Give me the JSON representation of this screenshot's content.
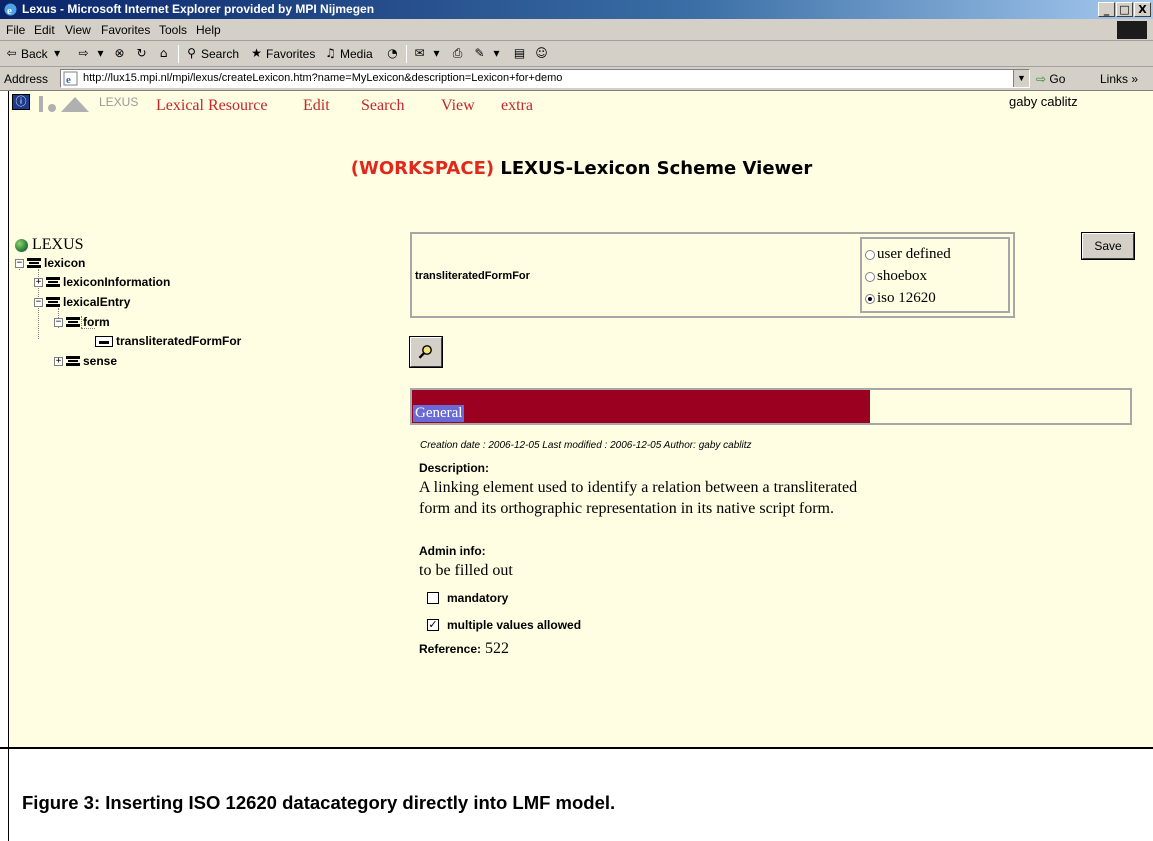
{
  "window": {
    "title": "Lexus - Microsoft Internet Explorer provided by MPI Nijmegen",
    "controls": {
      "minimize": "_",
      "maximize": "□",
      "close": "X"
    }
  },
  "menubar": [
    "File",
    "Edit",
    "View",
    "Favorites",
    "Tools",
    "Help"
  ],
  "toolbar": {
    "back": "Back",
    "search": "Search",
    "favorites": "Favorites",
    "media": "Media"
  },
  "addressbar": {
    "label": "Address",
    "url": "http://lux15.mpi.nl/mpi/lexus/createLexicon.htm?name=MyLexicon&description=Lexicon+for+demo",
    "go": "Go",
    "links": "Links »"
  },
  "lexus_nav": {
    "logo_text": "LEXUS",
    "links": [
      "Lexical Resource",
      "Edit",
      "Search",
      "View",
      "extra"
    ],
    "user": "gaby cablitz"
  },
  "page_title": {
    "workspace": "(WORKSPACE)",
    "title": "LEXUS-Lexicon Scheme Viewer"
  },
  "tree": {
    "root": "LEXUS",
    "nodes": {
      "lexicon": "lexicon",
      "lexiconInformation": "lexiconInformation",
      "lexicalEntry": "lexicalEntry",
      "form": "form",
      "transliteratedFormFor": "transliteratedFormFor",
      "sense": "sense"
    }
  },
  "category": {
    "name": "transliteratedFormFor",
    "options": [
      {
        "label": "user defined",
        "selected": false
      },
      {
        "label": "shoebox",
        "selected": false
      },
      {
        "label": "iso 12620",
        "selected": true
      }
    ]
  },
  "save_label": "Save",
  "general_label": "General",
  "meta_line": "Creation date : 2006-12-05 Last modified : 2006-12-05 Author: gaby cablitz",
  "description": {
    "label": "Description:",
    "text": "A linking element used to identify a relation between a transliterated form and its orthographic representation in its native script form."
  },
  "admin": {
    "label": "Admin info:",
    "text": "to be filled out"
  },
  "options": {
    "mandatory": {
      "label": "mandatory",
      "checked": false
    },
    "multiple": {
      "label": "multiple values allowed",
      "checked": true
    }
  },
  "reference": {
    "label": "Reference:",
    "value": "522"
  },
  "caption": "Figure 3: Inserting ISO 12620 datacategory directly into LMF model.",
  "colors": {
    "nav_red": "#c1272d",
    "workspace_red": "#e0281d",
    "general_bar": "#9b0020",
    "page_bg": "#fffde2"
  }
}
